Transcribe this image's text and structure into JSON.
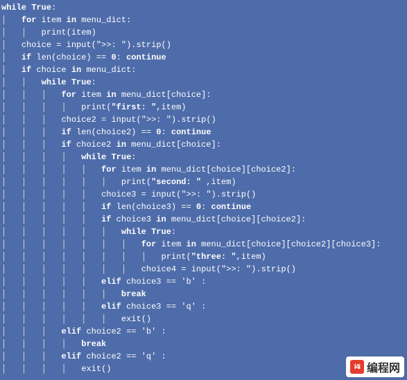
{
  "code": {
    "kw_while": "while",
    "kw_for": "for",
    "kw_in": "in",
    "kw_if": "if",
    "kw_elif": "elif",
    "kw_continue": "continue",
    "kw_break": "break",
    "lit_True": "True",
    "lit_0": "0",
    "id_item": "item",
    "id_menu_dict": "menu_dict",
    "id_print": "print",
    "id_input": "input",
    "id_strip": "strip",
    "id_len": "len",
    "id_exit": "exit",
    "id_choice": "choice",
    "id_choice2": "choice2",
    "id_choice3": "choice3",
    "id_choice4": "choice4",
    "str_prompt": "\">>: \"",
    "str_first": "\"first: \"",
    "str_second": "\"second: \"",
    "str_three": "\"three: \"",
    "str_b": "'b'",
    "str_q": "'q'"
  },
  "watermark": {
    "logo": "l4i",
    "text": "编程网"
  }
}
